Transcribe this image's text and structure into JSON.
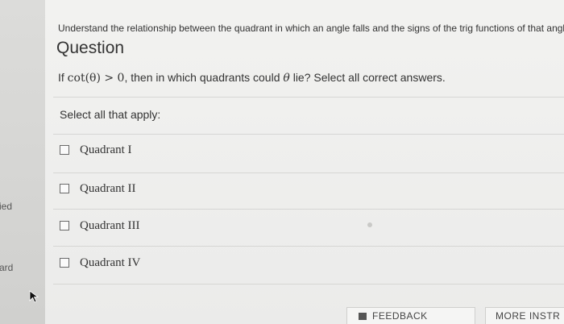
{
  "sidebar": {
    "partial_label_1": "ied",
    "partial_label_2": "ard"
  },
  "header": {
    "subtitle": "Understand the relationship between the quadrant in which an angle falls and the signs of the trig functions of that angle",
    "heading": "Question"
  },
  "question": {
    "prefix": "If ",
    "math_expr": "cot(θ) > 0",
    "middle": ", then in which quadrants could ",
    "variable": "θ",
    "suffix": " lie? Select all correct answers."
  },
  "answers": {
    "instruction": "Select all that apply:",
    "options": [
      {
        "label": "Quadrant I",
        "checked": false
      },
      {
        "label": "Quadrant II",
        "checked": false
      },
      {
        "label": "Quadrant III",
        "checked": false
      },
      {
        "label": "Quadrant IV",
        "checked": false
      }
    ]
  },
  "footer": {
    "feedback_label": "FEEDBACK",
    "more_label": "MORE INSTR"
  },
  "icons": {
    "feedback": "feedback-icon",
    "cursor": "cursor-icon"
  }
}
